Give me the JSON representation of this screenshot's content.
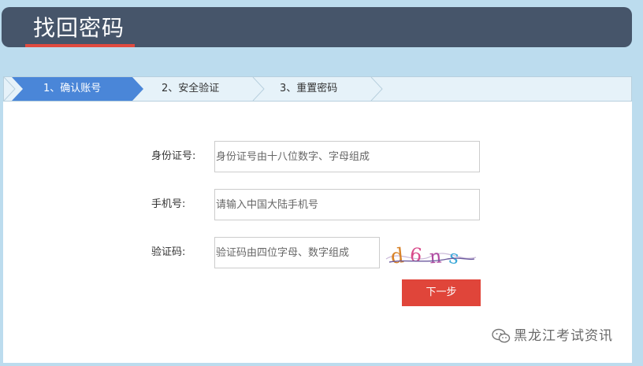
{
  "header": {
    "title": "找回密码"
  },
  "steps": [
    {
      "label": "1、确认账号",
      "active": true
    },
    {
      "label": "2、安全验证",
      "active": false
    },
    {
      "label": "3、重置密码",
      "active": false
    }
  ],
  "form": {
    "id_card": {
      "label": "身份证号:",
      "placeholder": "身份证号由十八位数字、字母组成",
      "value": ""
    },
    "phone": {
      "label": "手机号:",
      "placeholder": "请输入中国大陆手机号",
      "value": ""
    },
    "captcha": {
      "label": "验证码:",
      "placeholder": "验证码由四位字母、数字组成",
      "value": ""
    },
    "next_label": "下一步"
  },
  "captcha_image": {
    "text": "d6ns"
  },
  "watermark": {
    "icon": "wechat-icon",
    "text": "黑龙江考试资讯"
  },
  "colors": {
    "header_bg": "#46556a",
    "accent_red": "#e0453a",
    "active_step": "#4a86d8",
    "page_bg": "#bcdcee"
  }
}
